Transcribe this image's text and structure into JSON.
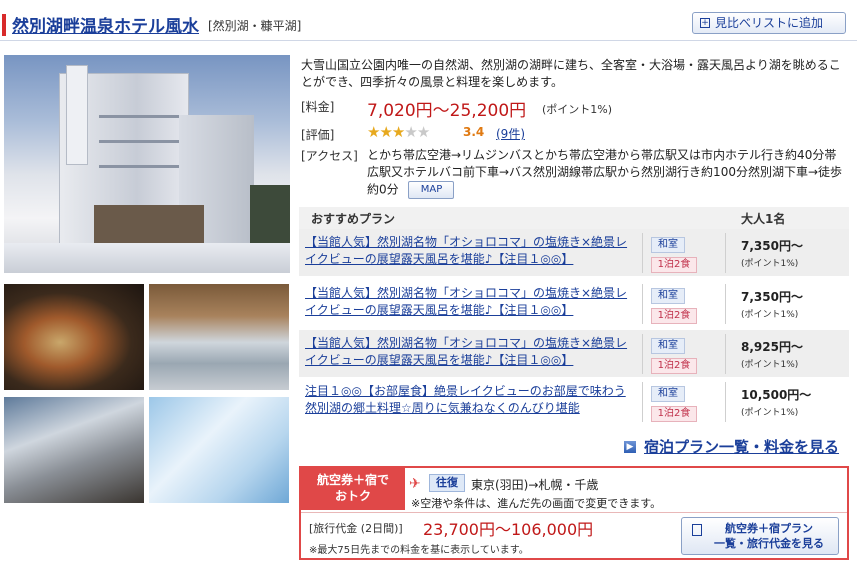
{
  "hotel": {
    "name": "然別湖畔温泉ホテル風水",
    "region": "[然別湖・糠平湖]",
    "compare_button": "見比べリストに追加",
    "description": "大雪山国立公園内唯一の自然湖、然別湖の湖畔に建ち、全客室・大浴場・露天風呂より湖を眺めることができ、四季折々の風景と料理を楽しめます。",
    "price_label": "[料金]",
    "price": "7,020円〜25,200円",
    "points": "(ポイント1%)",
    "rating_label": "[評価]",
    "rating_value": "3.4",
    "rating_stars": 3,
    "reviews": "(9件)",
    "access_label": "[アクセス]",
    "access": "とかち帯広空港→リムジンバスとかち帯広空港から帯広駅又は市内ホテル行き約40分帯広駅又ホテルバコ前下車→バス然別湖線帯広駅から然別湖行き約100分然別湖下車→徒歩約0分",
    "map_button": "MAP"
  },
  "plans": {
    "header_plan": "おすすめプラン",
    "header_price": "大人1名",
    "items": [
      {
        "name": "【当館人気】然別湖名物「オショロコマ」の塩焼き×絶景レイクビューの展望露天風呂を堪能♪【注目１◎◎】",
        "room": "和室",
        "meal": "1泊2食",
        "price": "7,350円〜",
        "points": "(ポイント1%)"
      },
      {
        "name": "【当館人気】然別湖名物「オショロコマ」の塩焼き×絶景レイクビューの展望露天風呂を堪能♪【注目１◎◎】",
        "room": "和室",
        "meal": "1泊2食",
        "price": "7,350円〜",
        "points": "(ポイント1%)"
      },
      {
        "name": "【当館人気】然別湖名物「オショロコマ」の塩焼き×絶景レイクビューの展望露天風呂を堪能♪【注目１◎◎】",
        "room": "和室",
        "meal": "1泊2食",
        "price": "8,925円〜",
        "points": "(ポイント1%)"
      },
      {
        "name": "注目１◎◎【お部屋食】絶景レイクビューのお部屋で味わう然別湖の郷土料理☆周りに気兼ねなくのんびり堪能",
        "room": "和室",
        "meal": "1泊2食",
        "price": "10,500円〜",
        "points": "(ポイント1%)"
      }
    ],
    "list_link": "宿泊プラン一覧・料金を見る"
  },
  "tour": {
    "badge_line1": "航空券＋宿で",
    "badge_line2": "おトク",
    "round_trip": "往復",
    "route": "東京(羽田)→札幌・千歳",
    "note1": "※空港や条件は、進んだ先の画面で変更できます。",
    "price_label": "[旅行代金 (2日間)]",
    "price": "23,700円〜106,000円",
    "note2": "※最大75日先までの料金を基に表示しています。",
    "button_line1": "航空券＋宿プラン",
    "button_line2": "一覧・旅行代金を見る"
  },
  "icons": {
    "compare": "plus-box-icon",
    "list_arrow": "arrow-right-icon",
    "plane": "airplane-icon",
    "tour_button": "copy-icon"
  },
  "colors": {
    "link": "#1b3f9a",
    "price": "#c01818",
    "accent": "#e04848",
    "star": "#e7a91e"
  }
}
